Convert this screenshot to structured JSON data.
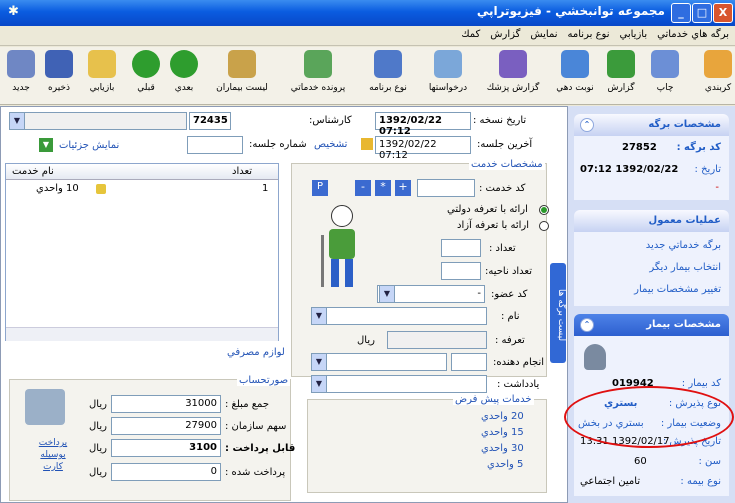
{
  "window": {
    "title": "مجموعه توانبخشي - فيزيوتراپي",
    "min_label": "_",
    "max_label": "□",
    "close_label": "X"
  },
  "menu": [
    "برگه هاي خدماتي",
    "بازيابي",
    "نوع برنامه",
    "نمايش",
    "گزارش",
    "كمك"
  ],
  "toolbar": [
    {
      "label": "كربندي",
      "icon": "gear-icon",
      "color": "#e8a53c"
    },
    {
      "label": "چاپ",
      "icon": "printer-icon",
      "color": "#6c8fd6"
    },
    {
      "label": "گزارش",
      "icon": "chart-icon",
      "color": "#3b9b3b"
    },
    {
      "label": "نوبت دهي",
      "icon": "clock-icon",
      "color": "#4a86d8"
    },
    {
      "label": "گزارش پزشك",
      "icon": "report-icon",
      "color": "#7a5fc0"
    },
    {
      "label": "درخواستها",
      "icon": "envelope-icon",
      "color": "#7ba7d9"
    },
    {
      "label": "نوع برنامه",
      "icon": "program-icon",
      "color": "#4f79c9"
    },
    {
      "label": "پرونده خدماتي",
      "icon": "folder-user-icon",
      "color": "#5aa55a"
    },
    {
      "label": "ليست بيماران",
      "icon": "patients-icon",
      "color": "#c9a24a"
    },
    {
      "label": "بعدي",
      "icon": "next-icon",
      "color": "#2e9d2e"
    },
    {
      "label": "قبلي",
      "icon": "prev-icon",
      "color": "#2e9d2e"
    },
    {
      "label": "بازيابي",
      "icon": "open-folder-icon",
      "color": "#e7c14c"
    },
    {
      "label": "ذخيره",
      "icon": "save-icon",
      "color": "#4062b5"
    },
    {
      "label": "جديد",
      "icon": "new-doc-icon",
      "color": "#6f87c4"
    }
  ],
  "form": {
    "date_label": "تاريخ نسخه :",
    "date_value": "1392/02/22 07:12",
    "last_session_label": "آخرين جلسه:",
    "last_session_value": "1392/02/22 07:12",
    "diagnosis_label": "تشخيص",
    "session_number_label": "شماره جلسه:",
    "session_number_value": "",
    "expert_label": "كارشناس:",
    "expert_code": "72435",
    "show_details": "نمايش جزئيات",
    "service_specs_title": "مشخصات خدمت",
    "service_code_label": "كد خدمت :",
    "service_code_value": "",
    "radio_gov": "ارائه با تعرفه دولتي",
    "radio_free": "ارائه با تعرفه آزاد",
    "count_label": "تعداد :",
    "region_count_label": "تعداد ناحيه:",
    "organ_code_label": "كد عضو:",
    "organ_code_value": "-",
    "name_label": "نام :",
    "tariff_label": "تعرفه :",
    "tariff_unit": "ريال",
    "performer_label": "انجام دهنده:",
    "note_label": "يادداشت :",
    "btn_p": "P",
    "btn_minus": "-",
    "btn_star": "*",
    "btn_plus": "+",
    "side_tab": "ليست برگه ها"
  },
  "service_table": {
    "headers": {
      "count": "تعداد",
      "name": "نام خدمت"
    },
    "rows": [
      {
        "count": "1",
        "name": "10 واحدي"
      }
    ]
  },
  "consumables_link": "لوازم مصرفي",
  "billing": {
    "title": "صورتحساب",
    "total_label": "جمع مبلغ :",
    "total_value": "31000",
    "org_share_label": "سهم سازمان :",
    "org_share_value": "27900",
    "payable_label": "قابل پرداخت :",
    "payable_value": "3100",
    "paid_label": "پرداخت شده :",
    "paid_value": "0",
    "currency": "ريال",
    "pay_card": "پرداخت بوسيله كارت"
  },
  "predefined": {
    "title": "خدمات پيش فرض",
    "items": [
      "20 واحدي",
      "15 واحدي",
      "30 واحدي",
      "5 واحدي"
    ]
  },
  "right_panel": {
    "sheet_title": "مشخصات برگه",
    "sheet_code_label": "كد برگه :",
    "sheet_code_value": "27852",
    "date_label": "تاريخ :",
    "date_value": "1392/02/22 07:12",
    "dash": "-",
    "ops_title": "عمليات معمول",
    "ops": [
      "برگه خدماتي جديد",
      "انتخاب بيمار ديگر",
      "تغيير مشخصات بيمار"
    ],
    "patient_title": "مشخصات بيمار",
    "patient_code_label": "كد بيمار :",
    "patient_code_value": "019942",
    "admission_label": "نوع پذيرش :",
    "admission_value": "بستري",
    "status_label": "وضعيت بيمار :",
    "status_value": "بستري در بخش",
    "admit_date_label": "تاريخ پذيرش :",
    "admit_date_value": "1392/02/17 13:31",
    "age_label": "سن :",
    "age_value": "60",
    "insurance_label": "نوع بيمه :",
    "insurance_value": "تامين اجتماعي"
  }
}
